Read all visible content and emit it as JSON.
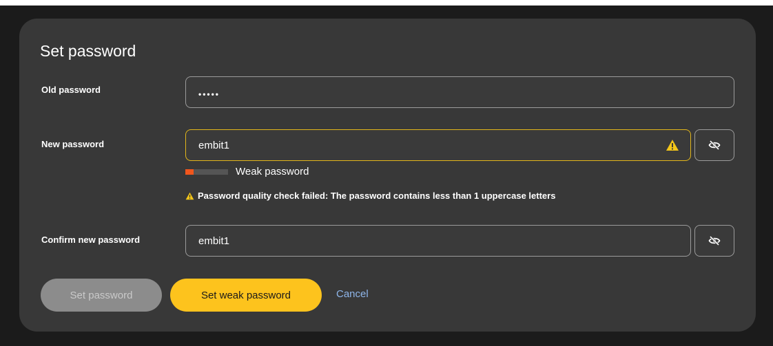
{
  "dialog": {
    "title": "Set password"
  },
  "fields": {
    "old_password": {
      "label": "Old password",
      "value": "•••••"
    },
    "new_password": {
      "label": "New password",
      "value": "embit1",
      "strength_label": "Weak password",
      "strength_level": 0.2,
      "hint": "Password quality check failed: The password contains less than 1 uppercase letters"
    },
    "confirm_password": {
      "label": "Confirm new password",
      "value": "embit1"
    }
  },
  "actions": {
    "set_password": "Set password",
    "set_weak_password": "Set weak password",
    "cancel": "Cancel"
  },
  "icons": {
    "warning": "warning-icon",
    "visibility": "eye-slash-icon"
  },
  "colors": {
    "accent": "#fdc31d",
    "warning": "#e5b81a",
    "strength_weak": "#f0561d",
    "link": "#8fb6ea",
    "dialog_bg": "#383838"
  }
}
